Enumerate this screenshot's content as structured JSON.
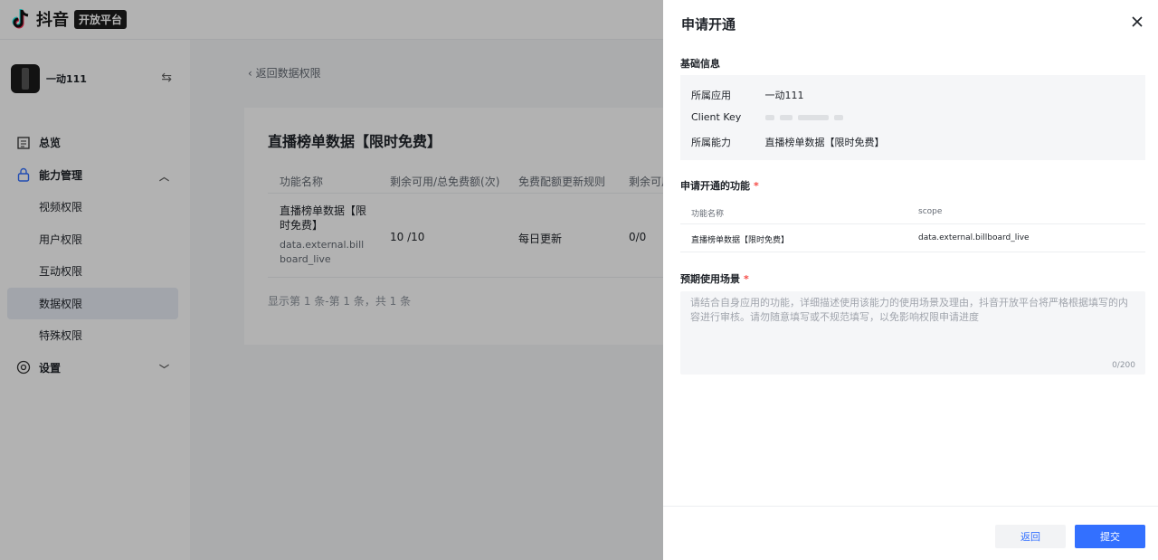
{
  "topbar": {
    "logo_text": "抖音",
    "logo_badge": "开放平台"
  },
  "sidebar": {
    "app_name": "一动111",
    "menu": [
      {
        "label": "总览",
        "icon": "overview-icon",
        "bold": true
      },
      {
        "label": "能力管理",
        "icon": "lock-icon",
        "bold": true,
        "expanded": true
      },
      {
        "label": "视频权限",
        "sub": true
      },
      {
        "label": "用户权限",
        "sub": true
      },
      {
        "label": "互动权限",
        "sub": true
      },
      {
        "label": "数据权限",
        "sub": true,
        "active": true
      },
      {
        "label": "特殊权限",
        "sub": true
      },
      {
        "label": "设置",
        "icon": "settings-icon",
        "bold": true,
        "expanded": false
      }
    ]
  },
  "main": {
    "back_label": "返回数据权限",
    "card_title": "直播榜单数据【限时免费】",
    "columns": [
      "功能名称",
      "剩余可用/总免费额(次)",
      "免费配额更新规则",
      "剩余可用"
    ],
    "row": {
      "name": "直播榜单数据【限时免费】",
      "scope": "data.external.billboard_live",
      "quota": "10 /10",
      "rule": "每日更新",
      "remain": "0/0"
    },
    "pagination": "显示第 1 条-第 1 条，共 1 条"
  },
  "drawer": {
    "title": "申请开通",
    "basic_info_label": "基础信息",
    "info": {
      "app_key": "所属应用",
      "app_val": "一动111",
      "client_key": "Client Key",
      "ability_key": "所属能力",
      "ability_val": "直播榜单数据【限时免费】"
    },
    "func_label": "申请开通的功能",
    "func_columns": [
      "功能名称",
      "scope"
    ],
    "func_row": {
      "name": "直播榜单数据【限时免费】",
      "scope": "data.external.billboard_live"
    },
    "scene_label": "预期使用场景",
    "required_mark": "*",
    "scene_placeholder": "请结合自身应用的功能，详细描述使用该能力的使用场景及理由，抖音开放平台将严格根据填写的内容进行审核。请勿随意填写或不规范填写，以免影响权限申请进度",
    "scene_count": "0/200",
    "btn_back": "返回",
    "btn_submit": "提交"
  },
  "colors": {
    "primary": "#3370ff",
    "required": "#f54a45",
    "overlay": "rgba(0,0,0,0.3)"
  }
}
